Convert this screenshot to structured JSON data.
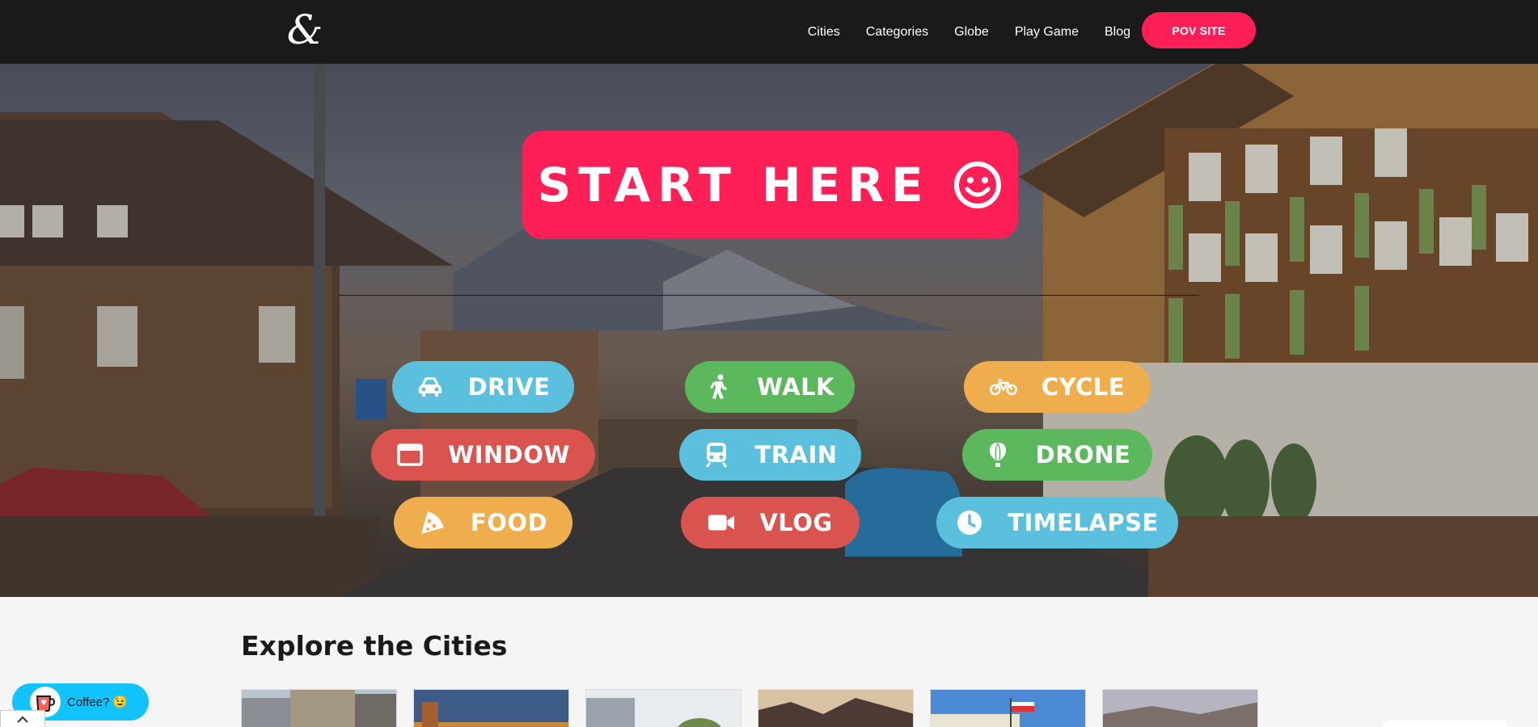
{
  "nav": {
    "logo_text": "&",
    "links": [
      "Cities",
      "Categories",
      "Globe",
      "Play Game",
      "Blog"
    ],
    "cta": "POV SITE"
  },
  "hero": {
    "start_label": "START HERE",
    "categories": [
      {
        "label": "DRIVE",
        "icon": "car-icon",
        "color": "#5bc0de"
      },
      {
        "label": "WALK",
        "icon": "walking-person-icon",
        "color": "#5cb85c"
      },
      {
        "label": "CYCLE",
        "icon": "bicycle-icon",
        "color": "#f0ad4e"
      },
      {
        "label": "WINDOW",
        "icon": "window-icon",
        "color": "#d9534f"
      },
      {
        "label": "TRAIN",
        "icon": "train-icon",
        "color": "#5bc0de"
      },
      {
        "label": "DRONE",
        "icon": "hot-air-balloon-icon",
        "color": "#5cb85c"
      },
      {
        "label": "FOOD",
        "icon": "pizza-icon",
        "color": "#f0ad4e"
      },
      {
        "label": "VLOG",
        "icon": "video-camera-icon",
        "color": "#d9534f"
      },
      {
        "label": "TIMELAPSE",
        "icon": "clock-icon",
        "color": "#5bc0de"
      }
    ]
  },
  "explore": {
    "title": "Explore the Cities"
  },
  "coffee": {
    "label": "Coffee? 😉"
  },
  "colors": {
    "brand": "#ff1f57",
    "navbar": "#1a1a1a",
    "coffee": "#13c3ff"
  }
}
